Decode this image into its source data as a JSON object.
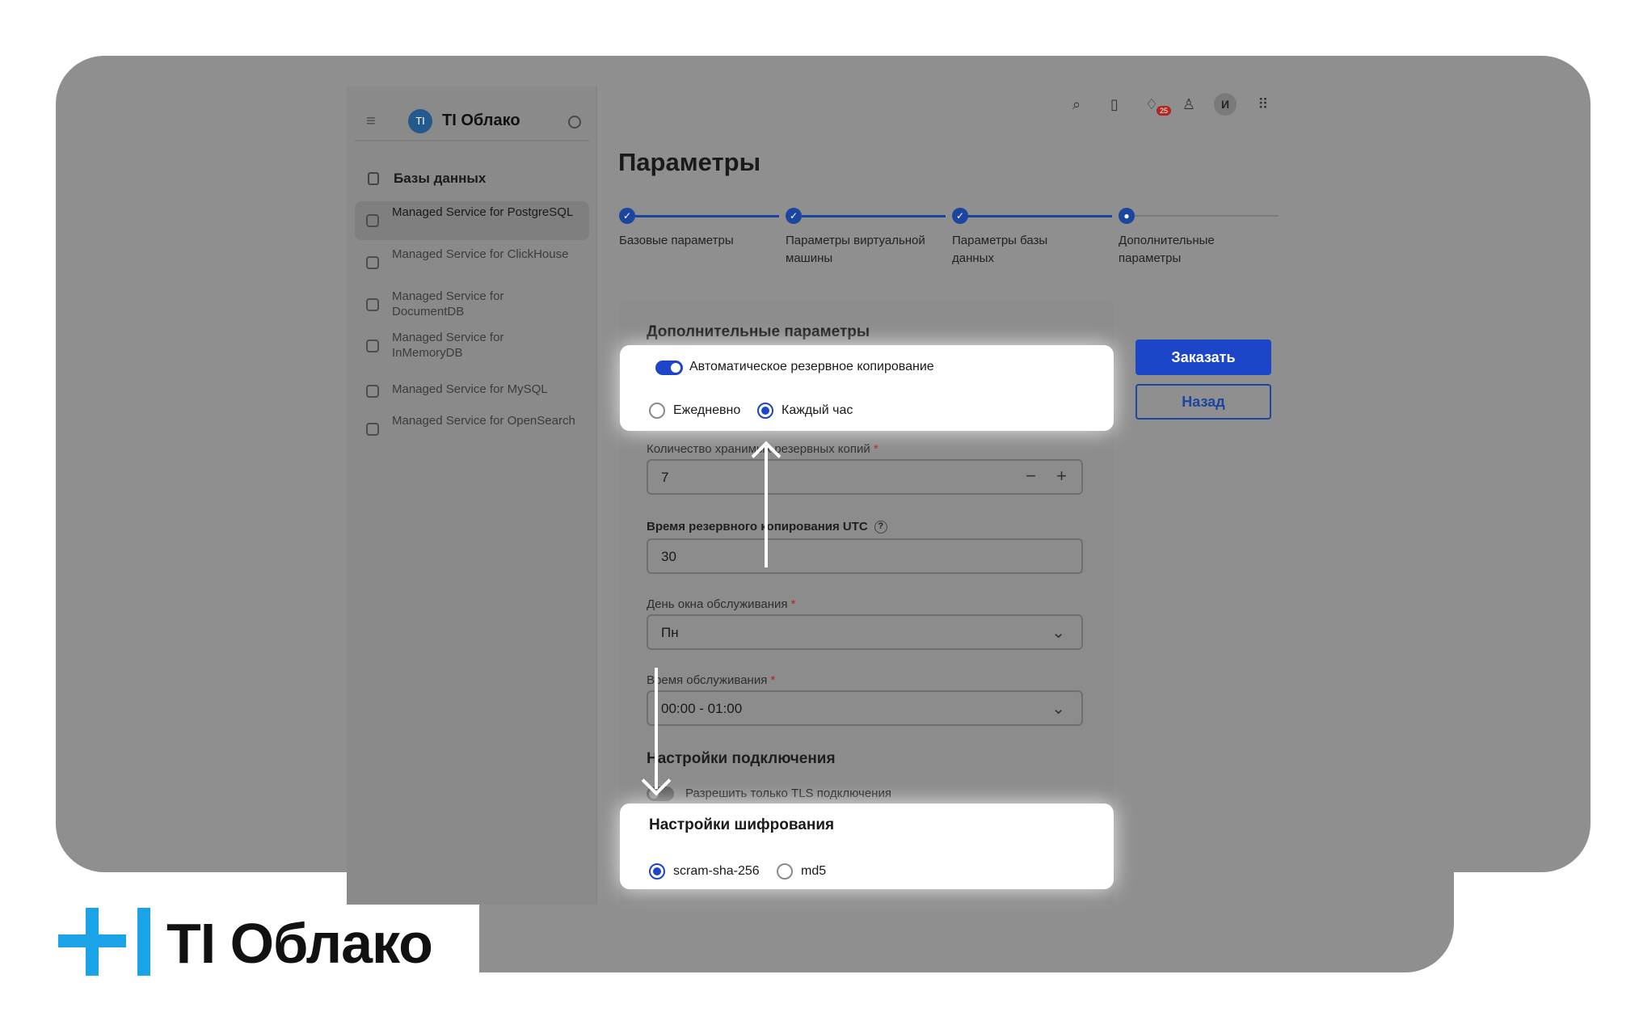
{
  "brand": {
    "name": "TI Облако",
    "logo_short": "TI"
  },
  "sidebar": {
    "logo_text": "TI Облако",
    "section_title": "Базы данных",
    "items": [
      {
        "label": "Managed Service for PostgreSQL",
        "icon": "postgresql-icon",
        "active": true
      },
      {
        "label": "Managed Service for ClickHouse",
        "icon": "clickhouse-icon",
        "active": false
      },
      {
        "label": "Managed Service for DocumentDB",
        "icon": "documentdb-icon",
        "active": false
      },
      {
        "label": "Managed Service for InMemoryDB",
        "icon": "inmemorydb-icon",
        "active": false
      },
      {
        "label": "Managed Service for MySQL",
        "icon": "mysql-icon",
        "active": false
      },
      {
        "label": "Managed Service for OpenSearch",
        "icon": "opensearch-icon",
        "active": false
      }
    ]
  },
  "topbar": {
    "icons": [
      "search-icon",
      "docs-icon",
      "bell-icon",
      "user-settings-icon",
      "avatar",
      "apps-grid-icon"
    ],
    "notifications_count": "25",
    "avatar_letter": "И"
  },
  "page": {
    "title": "Параметры",
    "steps": [
      {
        "label": "Базовые параметры",
        "status": "done"
      },
      {
        "label": "Параметры виртуальной машины",
        "status": "done"
      },
      {
        "label": "Параметры базы данных",
        "status": "done"
      },
      {
        "label": "Дополнительные параметры",
        "status": "current"
      }
    ]
  },
  "form": {
    "title": "Дополнительные параметры",
    "auto_backup": {
      "label": "Автоматическое резервное копирование",
      "enabled": true
    },
    "backup_frequency": {
      "options": [
        "Ежедневно",
        "Каждый час"
      ],
      "selected": "Каждый час"
    },
    "backup_count": {
      "label": "Количество хранимых резервных копий",
      "value": "7"
    },
    "backup_time": {
      "label": "Время резервного копирования UTC",
      "value": "30"
    },
    "maintenance_day": {
      "label": "День окна обслуживания",
      "value": "Пн"
    },
    "maintenance_time": {
      "label": "Время обслуживания",
      "value": "00:00 - 01:00"
    },
    "connection": {
      "title": "Настройки подключения",
      "tls_only": {
        "label": "Разрешить только TLS подключения",
        "enabled": false
      }
    },
    "encryption": {
      "title": "Настройки шифрования",
      "options": [
        "scram-sha-256",
        "md5"
      ],
      "selected": "scram-sha-256"
    }
  },
  "actions": {
    "order": "Заказать",
    "back": "Назад"
  },
  "colors": {
    "accent": "#1c45c8",
    "brand_blue": "#1aa3e6",
    "frame_gray": "#8f8f8f"
  }
}
